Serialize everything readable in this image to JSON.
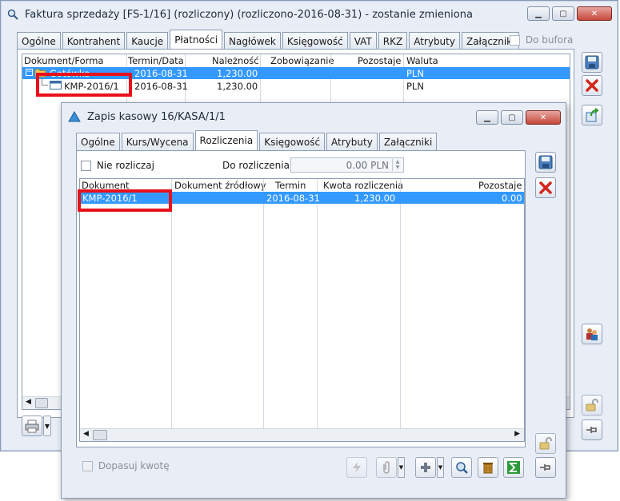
{
  "outer_window": {
    "title": "Faktura sprzedaży [FS-1/16] (rozliczony) (rozliczono-2016-08-31) - zostanie zmieniona",
    "tabs": [
      "Ogólne",
      "Kontrahent",
      "Kaucje",
      "Płatności",
      "Nagłówek",
      "Księgowość",
      "VAT",
      "RKZ",
      "Atrybuty",
      "Załączniki"
    ],
    "active_tab": "Płatności",
    "do_bufora_label": "Do bufora",
    "grid": {
      "columns": [
        "Dokument/Forma",
        "Termin/Data",
        "Należność",
        "Zobowiązanie",
        "Pozostaje",
        "Waluta"
      ],
      "rows": [
        {
          "doc": "Gotówka",
          "date": "2016-08-31",
          "due": "1,230.00",
          "liab": "",
          "left": "",
          "currency": "PLN"
        },
        {
          "doc": "KMP-2016/1",
          "date": "2016-08-31",
          "due": "1,230.00",
          "liab": "",
          "left": "",
          "currency": "PLN"
        }
      ]
    }
  },
  "inner_window": {
    "title": "Zapis kasowy 16/KASA/1/1",
    "tabs": [
      "Ogólne",
      "Kurs/Wycena",
      "Rozliczenia",
      "Księgowość",
      "Atrybuty",
      "Załączniki"
    ],
    "active_tab": "Rozliczenia",
    "nie_rozliczaj_label": "Nie rozliczaj",
    "do_rozliczenia_label": "Do rozliczenia:",
    "do_rozliczenia_value": "0.00 PLN",
    "grid": {
      "columns": [
        "Dokument",
        "Dokument źródłowy",
        "Termin",
        "Kwota rozliczenia",
        "Pozostaje"
      ],
      "rows": [
        {
          "doc": "KMP-2016/1",
          "source": "",
          "date": "2016-08-31",
          "amount": "1,230.00",
          "left": "0.00"
        }
      ]
    },
    "dopasuj_label": "Dopasuj kwotę"
  },
  "colors": {
    "selection": "#3399ff",
    "highlight": "#e8111b"
  }
}
